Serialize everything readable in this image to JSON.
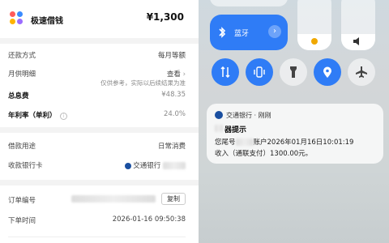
{
  "app": {
    "name": "极速借钱",
    "amount": "¥1,300"
  },
  "loan": {
    "repay_method_label": "还款方式",
    "repay_method_value": "每月等额",
    "monthly_label": "月供明细",
    "monthly_value": "查看",
    "monthly_note": "仅供参考，实际以后续结果为准",
    "total_fee_label": "总息费",
    "total_fee_value": "¥48.35",
    "annual_rate_label": "年利率（单利）",
    "annual_rate_value": "24.0%",
    "purpose_label": "借款用途",
    "purpose_value": "日常消费",
    "bank_label": "收款银行卡",
    "bank_value": "交通银行",
    "order_label": "订单编号",
    "copy_label": "复制",
    "time_label": "下单时间",
    "time_value": "2026-01-16 09:50:38"
  },
  "control_center": {
    "bluetooth_label": "蓝牙",
    "colors": {
      "accent": "#2f7cf6"
    },
    "toggles": [
      "mobile-data-icon",
      "vibrate-icon",
      "flashlight-icon",
      "location-icon",
      "airplane-icon"
    ]
  },
  "notification": {
    "source": "交通银行 · 刚刚",
    "title": "器提示",
    "line1_prefix": "您尾号",
    "line1_suffix": "账户2026年01月16日10:01:19",
    "line2": "收入（通联支付）1300.00元。"
  }
}
